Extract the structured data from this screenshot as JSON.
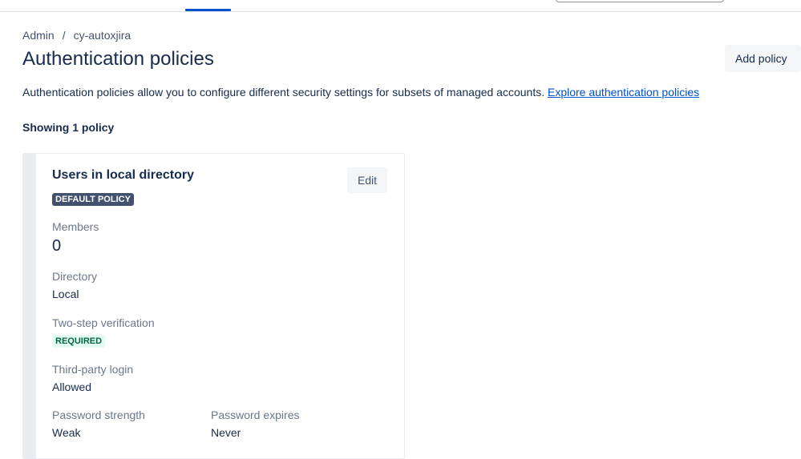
{
  "breadcrumb": {
    "items": [
      "Admin",
      "cy-autoxjira"
    ],
    "separator": "/"
  },
  "page": {
    "title": "Authentication policies",
    "add_button": "Add policy",
    "description": "Authentication policies allow you to configure different security settings for subsets of managed accounts.",
    "description_link": "Explore authentication policies",
    "showing": "Showing 1 policy"
  },
  "policy": {
    "title": "Users in local directory",
    "badge": "DEFAULT POLICY",
    "edit_label": "Edit",
    "members_label": "Members",
    "members_value": "0",
    "directory_label": "Directory",
    "directory_value": "Local",
    "two_step_label": "Two-step verification",
    "two_step_badge": "REQUIRED",
    "third_party_label": "Third-party login",
    "third_party_value": "Allowed",
    "password_strength_label": "Password strength",
    "password_strength_value": "Weak",
    "password_expires_label": "Password expires",
    "password_expires_value": "Never"
  },
  "colors": {
    "accent": "#0052cc",
    "text": "#172b4d",
    "muted": "#6b778c",
    "badge_default": "#42526e",
    "badge_success_bg": "#e3fcef",
    "badge_success_text": "#006644"
  }
}
